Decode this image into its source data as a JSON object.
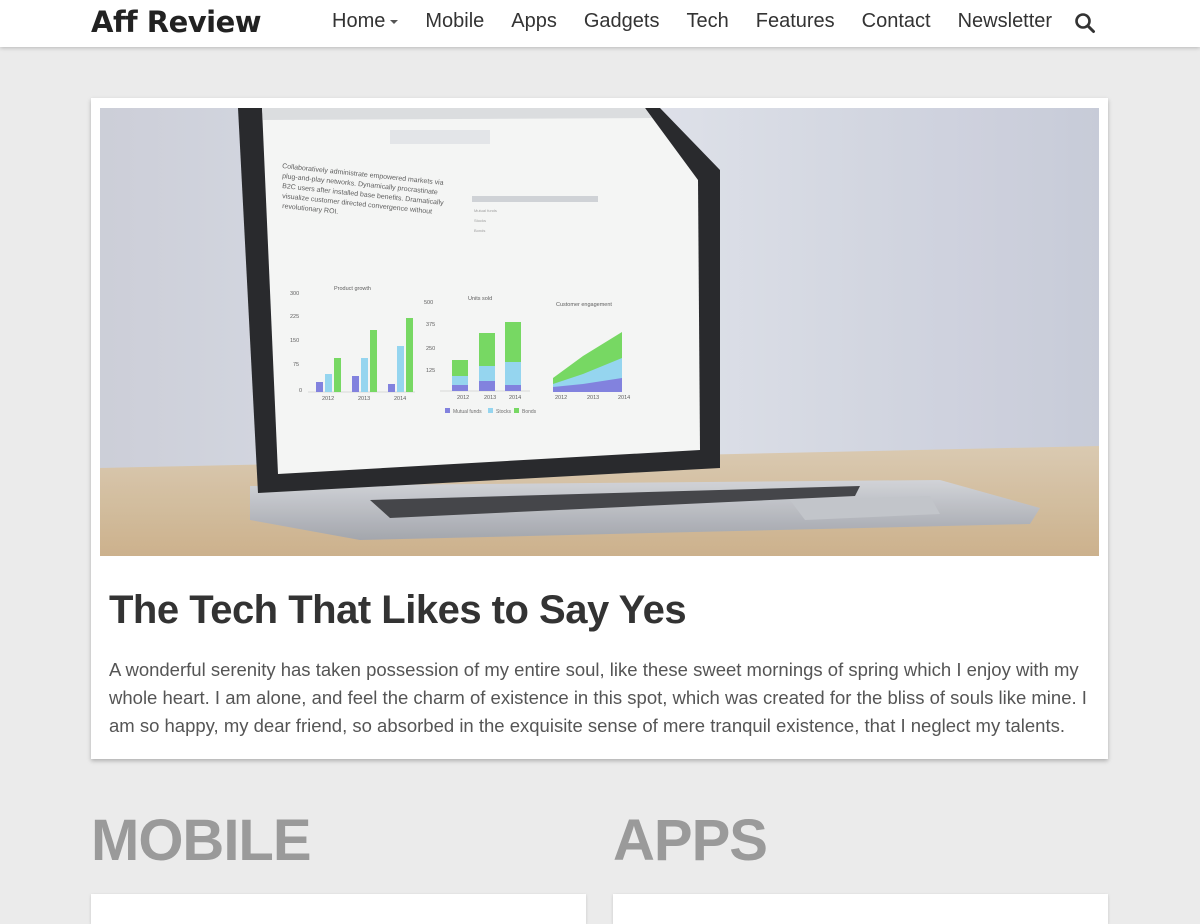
{
  "site": {
    "logo": "Aff Review"
  },
  "nav": {
    "items": [
      {
        "label": "Home",
        "has_dropdown": true
      },
      {
        "label": "Mobile"
      },
      {
        "label": "Apps"
      },
      {
        "label": "Gadgets"
      },
      {
        "label": "Tech"
      },
      {
        "label": "Features"
      },
      {
        "label": "Contact"
      },
      {
        "label": "Newsletter"
      }
    ],
    "search_icon": "search-icon"
  },
  "featured": {
    "title": "The Tech That Likes to Say Yes",
    "excerpt": "A wonderful serenity has taken possession of my entire soul, like these sweet mornings of spring which I enjoy with my whole heart. I am alone, and feel the charm of existence in this spot, which was created for the bliss of souls like mine. I am so happy, my dear friend, so absorbed in the exquisite sense of mere tranquil existence, that I neglect my talents.",
    "image": {
      "screen_text": "Collaboratively administrate empowered markets via plug-and-play networks. Dynamically procrastinate B2C users after installed base benefits. Dramatically visualize customer directed convergence without revolutionary ROI.",
      "chart1_title": "Product growth",
      "chart1_ticks": [
        "300",
        "225",
        "150",
        "75",
        "0"
      ],
      "chart1_years": [
        "2012",
        "2013",
        "2014"
      ],
      "chart2_title": "Units sold",
      "chart3_title": "Customer engagement",
      "legend": [
        "Mutual funds",
        "Stocks",
        "Bonds"
      ]
    }
  },
  "sections": [
    {
      "title": "MOBILE"
    },
    {
      "title": "APPS"
    }
  ],
  "colors": {
    "background": "#ebebeb",
    "header": "#ffffff",
    "section_heading": "#9a9a9a"
  }
}
